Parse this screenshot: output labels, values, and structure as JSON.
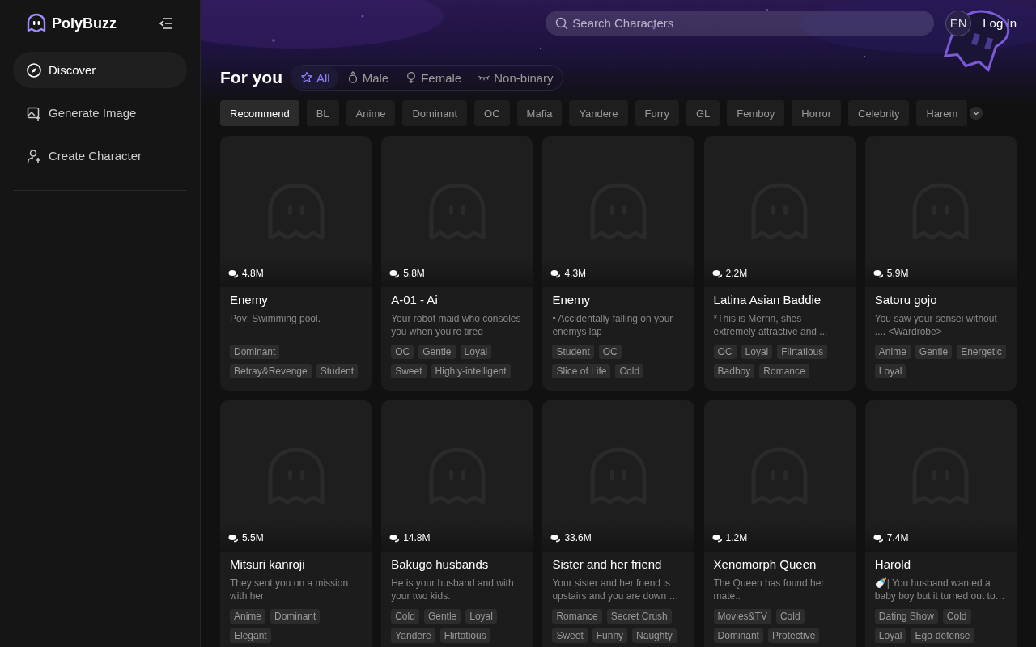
{
  "brand": {
    "name": "PolyBuzz"
  },
  "sidebar": {
    "items": [
      {
        "label": "Discover",
        "selected": true
      },
      {
        "label": "Generate Image",
        "selected": false
      },
      {
        "label": "Create Character",
        "selected": false
      }
    ]
  },
  "header": {
    "search": {
      "placeholder": "Search Characters"
    },
    "language": "EN",
    "login": "Log In"
  },
  "section_title": "For you",
  "gender_tabs": [
    {
      "label": "All",
      "selected": true
    },
    {
      "label": "Male",
      "selected": false
    },
    {
      "label": "Female",
      "selected": false
    },
    {
      "label": "Non-binary",
      "selected": false
    }
  ],
  "categories": [
    {
      "label": "Recommend",
      "selected": true
    },
    {
      "label": "BL",
      "selected": false
    },
    {
      "label": "Anime",
      "selected": false
    },
    {
      "label": "Dominant",
      "selected": false
    },
    {
      "label": "OC",
      "selected": false
    },
    {
      "label": "Mafia",
      "selected": false
    },
    {
      "label": "Yandere",
      "selected": false
    },
    {
      "label": "Furry",
      "selected": false
    },
    {
      "label": "GL",
      "selected": false
    },
    {
      "label": "Femboy",
      "selected": false
    },
    {
      "label": "Horror",
      "selected": false
    },
    {
      "label": "Celebrity",
      "selected": false
    },
    {
      "label": "Harem",
      "selected": false
    }
  ],
  "cards": [
    {
      "count": "4.8M",
      "title": "Enemy",
      "description": "Pov: Swimming pool.",
      "tags": [
        "Dominant",
        "Betray&Revenge",
        "Student"
      ]
    },
    {
      "count": "5.8M",
      "title": "A-01 - Ai",
      "description": "Your robot maid who consoles you when you're tired",
      "tags": [
        "OC",
        "Gentle",
        "Loyal",
        "Sweet",
        "Highly-intelligent"
      ]
    },
    {
      "count": "4.3M",
      "title": "Enemy",
      "description": "• Accidentally falling on your enemys lap",
      "tags": [
        "Student",
        "OC",
        "Slice of Life",
        "Cold"
      ]
    },
    {
      "count": "2.2M",
      "title": "Latina Asian Baddie",
      "description": "*This is Merrin, shes extremely attractive and ...",
      "tags": [
        "OC",
        "Loyal",
        "Flirtatious",
        "Badboy",
        "Romance"
      ]
    },
    {
      "count": "5.9M",
      "title": "Satoru gojo",
      "description": "You saw your sensei without .... <Wardrobe>",
      "tags": [
        "Anime",
        "Gentle",
        "Energetic",
        "Loyal"
      ]
    },
    {
      "count": "5.5M",
      "title": "Mitsuri kanroji",
      "description": "They sent you on a mission with her",
      "tags": [
        "Anime",
        "Dominant",
        "Elegant"
      ]
    },
    {
      "count": "14.8M",
      "title": "Bakugo husbands",
      "description": "He is your husband and with your two kids.",
      "tags": [
        "Cold",
        "Gentle",
        "Loyal",
        "Yandere",
        "Flirtatious"
      ]
    },
    {
      "count": "33.6M",
      "title": "Sister and her friend",
      "description": "Your sister and her friend is upstairs and you are down …",
      "tags": [
        "Romance",
        "Secret Crush",
        "Sweet",
        "Funny",
        "Naughty"
      ]
    },
    {
      "count": "1.2M",
      "title": "Xenomorph Queen",
      "description": "The Queen has found her mate..",
      "tags": [
        "Movies&TV",
        "Cold",
        "Dominant",
        "Protective"
      ]
    },
    {
      "count": "7.4M",
      "title": "Harold",
      "description": "🍼| You husband wanted a baby boy but it turned out to…",
      "tags": [
        "Dating Show",
        "Cold",
        "Loyal",
        "Ego-defense"
      ]
    }
  ]
}
